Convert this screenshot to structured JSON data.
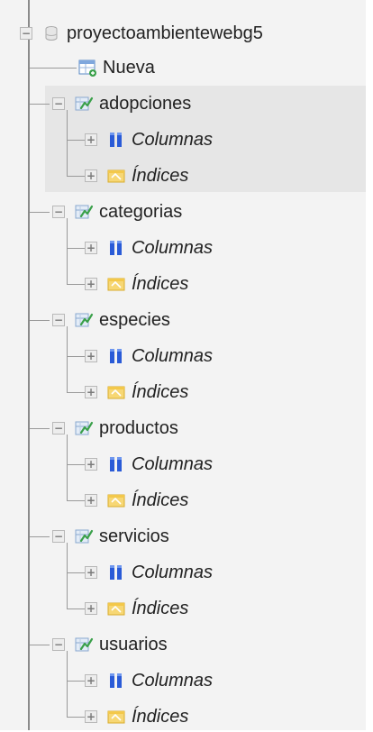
{
  "database": {
    "name": "proyectoambientewebg5",
    "icon": "database-icon",
    "expander": "−"
  },
  "new_item": {
    "label": "Nueva",
    "icon": "new-table-icon"
  },
  "tables": [
    {
      "name": "adopciones",
      "expander": "−",
      "children": [
        {
          "label": "Columnas",
          "expander": "+"
        },
        {
          "label": "Índices",
          "expander": "+"
        }
      ]
    },
    {
      "name": "categorias",
      "expander": "−",
      "children": [
        {
          "label": "Columnas",
          "expander": "+"
        },
        {
          "label": "Índices",
          "expander": "+"
        }
      ]
    },
    {
      "name": "especies",
      "expander": "−",
      "children": [
        {
          "label": "Columnas",
          "expander": "+"
        },
        {
          "label": "Índices",
          "expander": "+"
        }
      ]
    },
    {
      "name": "productos",
      "expander": "−",
      "children": [
        {
          "label": "Columnas",
          "expander": "+"
        },
        {
          "label": "Índices",
          "expander": "+"
        }
      ]
    },
    {
      "name": "servicios",
      "expander": "−",
      "children": [
        {
          "label": "Columnas",
          "expander": "+"
        },
        {
          "label": "Índices",
          "expander": "+"
        }
      ]
    },
    {
      "name": "usuarios",
      "expander": "−",
      "children": [
        {
          "label": "Columnas",
          "expander": "+"
        },
        {
          "label": "Índices",
          "expander": "+"
        }
      ]
    }
  ],
  "colors": {
    "panel_bg": "#f3f3f3",
    "hover_bg": "#e6e6e6",
    "tree_line": "#9a9a9a",
    "columns_icon": "#2a5bd7",
    "index_icon": "#f3c84a",
    "table_icon_accent": "#3aa04a"
  }
}
